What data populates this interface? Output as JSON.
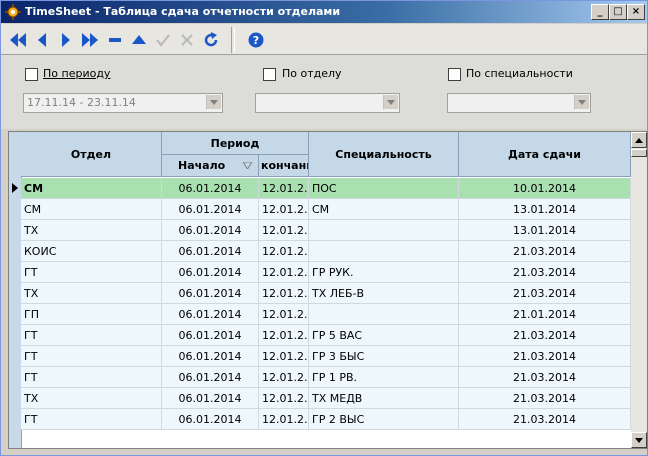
{
  "window": {
    "title": "TimeSheet - Таблица сдача отчетности отделами"
  },
  "titlebar_buttons": {
    "minimize": "_",
    "maximize": "□",
    "close": "×"
  },
  "filters": {
    "by_period": {
      "label": "По периоду",
      "value": "17.11.14 - 23.11.14"
    },
    "by_department": {
      "label": "По отделу",
      "value": ""
    },
    "by_specialty": {
      "label": "По специальности",
      "value": ""
    }
  },
  "table": {
    "headers": {
      "department": "Отдел",
      "period": "Период",
      "start": "Начало",
      "end": "кончани",
      "specialty": "Специальность",
      "submit_date": "Дата сдачи"
    },
    "rows": [
      {
        "department": "СМ",
        "start": "06.01.2014",
        "end": "12.01.2...",
        "specialty": "ПОС",
        "submit_date": "10.01.2014"
      },
      {
        "department": "СМ",
        "start": "06.01.2014",
        "end": "12.01.2...",
        "specialty": "СМ",
        "submit_date": "13.01.2014"
      },
      {
        "department": "ТХ",
        "start": "06.01.2014",
        "end": "12.01.2...",
        "specialty": "",
        "submit_date": "13.01.2014"
      },
      {
        "department": "КОИС",
        "start": "06.01.2014",
        "end": "12.01.2...",
        "specialty": "",
        "submit_date": "21.03.2014"
      },
      {
        "department": "ГТ",
        "start": "06.01.2014",
        "end": "12.01.2...",
        "specialty": "ГР РУК.",
        "submit_date": "21.03.2014"
      },
      {
        "department": "ТХ",
        "start": "06.01.2014",
        "end": "12.01.2...",
        "specialty": "ТХ ЛЕБ-В",
        "submit_date": "21.03.2014"
      },
      {
        "department": "ГП",
        "start": "06.01.2014",
        "end": "12.01.2...",
        "specialty": "",
        "submit_date": "21.01.2014"
      },
      {
        "department": "ГТ",
        "start": "06.01.2014",
        "end": "12.01.2...",
        "specialty": "ГР 5 ВАС",
        "submit_date": "21.03.2014"
      },
      {
        "department": "ГТ",
        "start": "06.01.2014",
        "end": "12.01.2...",
        "specialty": "ГР 3 БЫС",
        "submit_date": "21.03.2014"
      },
      {
        "department": "ГТ",
        "start": "06.01.2014",
        "end": "12.01.2...",
        "specialty": "ГР 1 РВ.",
        "submit_date": "21.03.2014"
      },
      {
        "department": "ТХ",
        "start": "06.01.2014",
        "end": "12.01.2...",
        "specialty": "ТХ МЕДВ",
        "submit_date": "21.03.2014"
      },
      {
        "department": "ГТ",
        "start": "06.01.2014",
        "end": "12.01.2...",
        "specialty": "ГР 2 ВЫС",
        "submit_date": "21.03.2014"
      }
    ]
  },
  "colors": {
    "selected_row": "#a8e0b0",
    "alt_row": "#eef8fc",
    "header": "#c4d8e8",
    "nav_icon": "#1a58c8"
  }
}
